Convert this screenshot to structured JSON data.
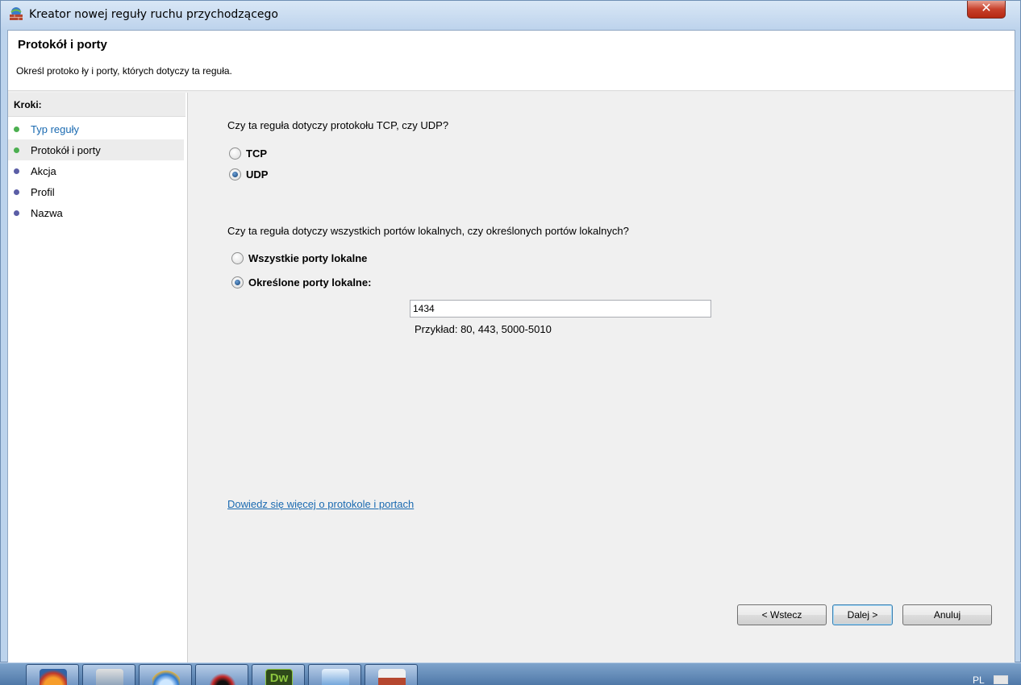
{
  "window": {
    "title": "Kreator nowej reguły ruchu przychodzącego",
    "close_glyph": "✕"
  },
  "header": {
    "title": "Protokół i porty",
    "description": "Określ protoko ły i porty, których dotyczy ta reguła."
  },
  "steps": {
    "heading": "Kroki:",
    "items": [
      {
        "label": "Typ reguły",
        "state": "done",
        "color": "#4caf50"
      },
      {
        "label": "Protokół i porty",
        "state": "current",
        "color": "#4caf50"
      },
      {
        "label": "Akcja",
        "state": "pending",
        "color": "#5b5ea6"
      },
      {
        "label": "Profil",
        "state": "pending",
        "color": "#5b5ea6"
      },
      {
        "label": "Nazwa",
        "state": "pending",
        "color": "#5b5ea6"
      }
    ]
  },
  "protocol": {
    "question": "Czy ta reguła dotyczy protokołu TCP, czy UDP?",
    "options": [
      {
        "label": "TCP",
        "checked": false
      },
      {
        "label": "UDP",
        "checked": true
      }
    ]
  },
  "ports": {
    "question": "Czy ta reguła dotyczy wszystkich portów lokalnych, czy określonych portów lokalnych?",
    "all_label": "Wszystkie porty lokalne",
    "specific_label": "Określone porty lokalne:",
    "selected": "specific",
    "value": "1434",
    "example": "Przykład: 80, 443, 5000-5010"
  },
  "help_link": "Dowiedz się więcej o protokole i portach",
  "buttons": {
    "back": "< Wstecz",
    "next": "Dalej >",
    "cancel": "Anuluj"
  },
  "taskbar": {
    "language": "PL",
    "apps": [
      "firefox-icon",
      "security-icon",
      "internet-explorer-icon",
      "app-red-icon",
      "dreamweaver-icon",
      "control-panel-icon",
      "firewall-icon"
    ],
    "dw_label": "Dw"
  },
  "colors": {
    "link": "#1a6ab1",
    "accent": "#3c7fb1"
  }
}
